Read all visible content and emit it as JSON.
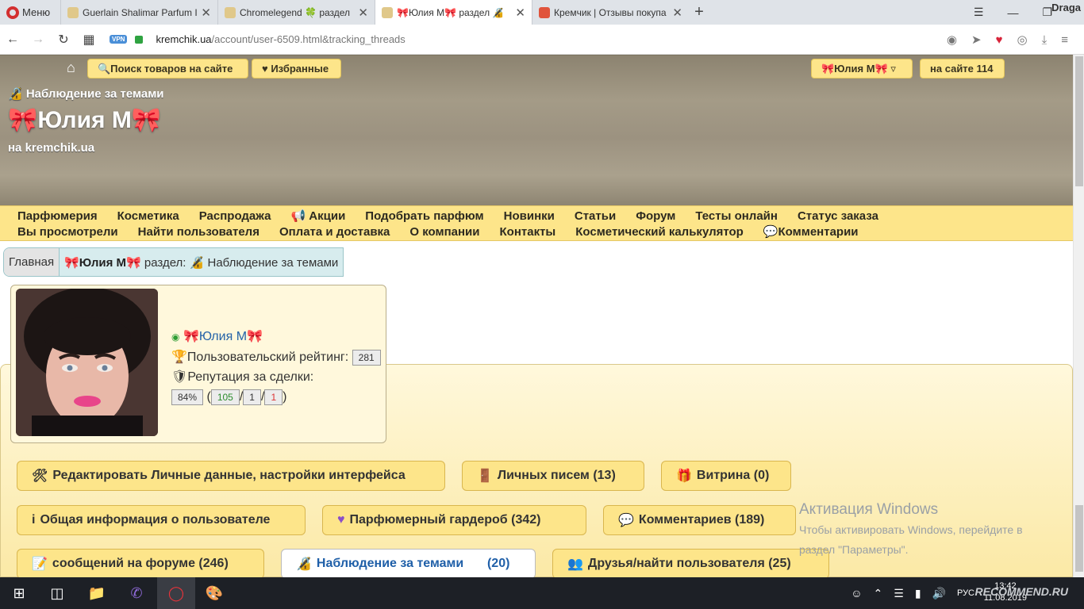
{
  "browser": {
    "menu_label": "Меню",
    "tabs": [
      {
        "label": "Guerlain Shalimar Parfum I",
        "active": false
      },
      {
        "label": "Chromelegend 🍀 раздел",
        "active": false
      },
      {
        "label": "🎀Юлия М🎀 раздел 🔏",
        "active": true
      },
      {
        "label": "Кремчик | Отзывы покупа",
        "active": false
      }
    ],
    "window_user": "Draga",
    "url_host": "kremchik.ua",
    "url_path": "/account/user-6509.html&tracking_threads",
    "vpn_label": "VPN"
  },
  "header": {
    "search_btn": "🔍Поиск товаров на сайте",
    "favorites_btn": "♥ Избранные",
    "user_btn": "🎀Юлия М🎀 ▿",
    "online_btn": "на сайте 114",
    "section_title": "🔏 Наблюдение за темами",
    "user_title": "🎀Юлия М🎀",
    "site_sub": "на kremchik.ua"
  },
  "nav": {
    "row1": [
      "Парфюмерия",
      "Косметика",
      "Распродажа",
      "📢 Акции",
      "Подобрать парфюм",
      "Новинки",
      "Статьи",
      "Форум",
      "Тесты онлайн",
      "Статус заказа"
    ],
    "row2": [
      "Вы просмотрели",
      "Найти пользователя",
      "Оплата и доставка",
      "О компании",
      "Контакты",
      "Косметический калькулятор",
      "💬Комментарии"
    ]
  },
  "breadcrumb": {
    "home": "Главная",
    "user": "🎀Юлия М🎀",
    "section": "раздел: 🔏 Наблюдение за темами"
  },
  "profile": {
    "name": "🎀Юлия М🎀",
    "rating_label": "Пользовательский рейтинг:",
    "rating_value": "281",
    "reputation_label": "Репутация за сделки:",
    "reputation_percent": "84%",
    "rep_positive": "105",
    "rep_neutral": "1",
    "rep_negative": "1"
  },
  "actions": {
    "edit": "Редактировать Личные данные, настройки интерфейса",
    "letters": "Личных писем (13)",
    "showcase": "Витрина (0)",
    "info": "Общая информация о пользователе",
    "wardrobe": "Парфюмерный гардероб (342)",
    "comments": "Комментариев (189)",
    "forum": "сообщений на форуме (246)",
    "tracking": "Наблюдение за темами",
    "tracking_count": "(20)",
    "friends": "Друзья/найти пользователя (25)"
  },
  "windows_activation": {
    "line1": "Активация Windows",
    "line2": "Чтобы активировать Windows, перейдите в",
    "line3": "раздел \"Параметры\"."
  },
  "taskbar": {
    "time": "13:42",
    "date": "11.08.2019",
    "lang": "РУС",
    "watermark": "RECOMMEND.RU"
  }
}
